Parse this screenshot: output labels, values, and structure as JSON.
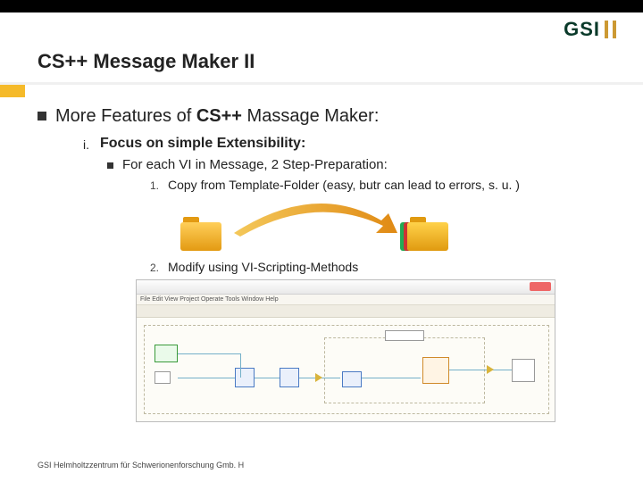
{
  "title": "CS++ Message Maker II",
  "logo_text": "GSI",
  "main_bullet": {
    "lead": "More Features of ",
    "strong": "CS++",
    "tail": " Massage Maker:"
  },
  "sub": {
    "roman": "i.",
    "text": "Focus on simple Extensibility:",
    "child": {
      "text": "For each VI in Message, 2 Step-Preparation:",
      "steps": [
        {
          "n": "1.",
          "text": "Copy from Template-Folder (easy, butr can lead to errors, s. u. )"
        },
        {
          "n": "2.",
          "text": "Modify using VI-Scripting-Methods"
        }
      ]
    }
  },
  "menu_text": "File  Edit  View  Project  Operate  Tools  Window  Help",
  "footer": "GSI Helmholtzzentrum für Schwerionenforschung Gmb. H"
}
